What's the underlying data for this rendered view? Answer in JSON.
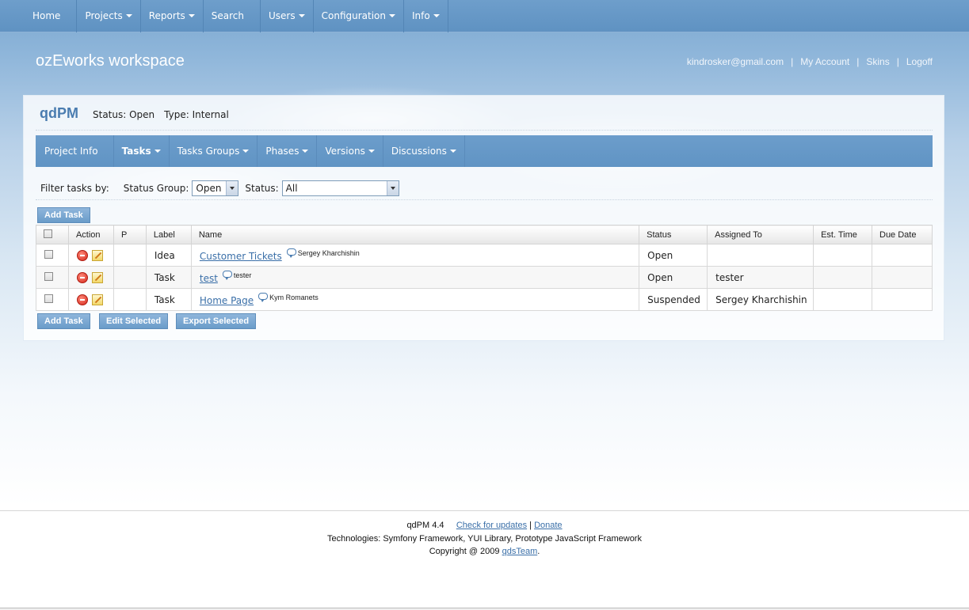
{
  "topnav": {
    "items": [
      {
        "label": "Home",
        "dropdown": false
      },
      {
        "label": "Projects",
        "dropdown": true
      },
      {
        "label": "Reports",
        "dropdown": true
      },
      {
        "label": "Search",
        "dropdown": false
      },
      {
        "label": "Users",
        "dropdown": true
      },
      {
        "label": "Configuration",
        "dropdown": true
      },
      {
        "label": "Info",
        "dropdown": true
      }
    ]
  },
  "header": {
    "workspace_title": "ozEworks workspace",
    "user_email": "kindrosker@gmail.com",
    "my_account": "My Account",
    "skins": "Skins",
    "logoff": "Logoff",
    "separator": "|"
  },
  "project": {
    "name": "qdPM",
    "status": "Status: Open",
    "type": "Type: Internal"
  },
  "subnav": {
    "items": [
      {
        "label": "Project Info",
        "dropdown": false,
        "active": false
      },
      {
        "label": "Tasks",
        "dropdown": true,
        "active": true
      },
      {
        "label": "Tasks Groups",
        "dropdown": true,
        "active": false
      },
      {
        "label": "Phases",
        "dropdown": true,
        "active": false
      },
      {
        "label": "Versions",
        "dropdown": true,
        "active": false
      },
      {
        "label": "Discussions",
        "dropdown": true,
        "active": false
      }
    ]
  },
  "filter": {
    "label": "Filter tasks by:",
    "status_group_label": "Status Group:",
    "status_group_value": "Open",
    "status_label": "Status:",
    "status_value": "All"
  },
  "buttons": {
    "add_task": "Add Task",
    "edit_selected": "Edit Selected",
    "export_selected": "Export Selected"
  },
  "table": {
    "headers": [
      "Action",
      "P",
      "Label",
      "Name",
      "Status",
      "Assigned To",
      "Est. Time",
      "Due Date"
    ],
    "rows": [
      {
        "p": "",
        "label": "Idea",
        "name": "Customer Tickets",
        "commenter": "Sergey Kharchishin",
        "status": "Open",
        "assigned": "",
        "est": "",
        "due": ""
      },
      {
        "p": "",
        "label": "Task",
        "name": "test",
        "commenter": "tester",
        "status": "Open",
        "assigned": "tester",
        "est": "",
        "due": ""
      },
      {
        "p": "",
        "label": "Task",
        "name": "Home Page",
        "commenter": "Kym Romanets",
        "status": "Suspended",
        "assigned": "Sergey Kharchishin",
        "est": "",
        "due": ""
      }
    ]
  },
  "footer": {
    "version": "qdPM 4.4",
    "check_updates": "Check for updates",
    "pipe": "|",
    "donate": "Donate",
    "technologies": "Technologies: Symfony Framework, YUI Library, Prototype JavaScript Framework",
    "copyright_prefix": "Copyright @ 2009",
    "team": "qdsTeam",
    "period": "."
  },
  "icons": {
    "delete": "delete-icon",
    "edit": "edit-icon",
    "comment": "comment-icon",
    "dropdown": "caret-down-icon"
  },
  "colors": {
    "nav": "#6e9ecb",
    "link": "#3a6fa8",
    "project_title": "#4a7cb0"
  }
}
